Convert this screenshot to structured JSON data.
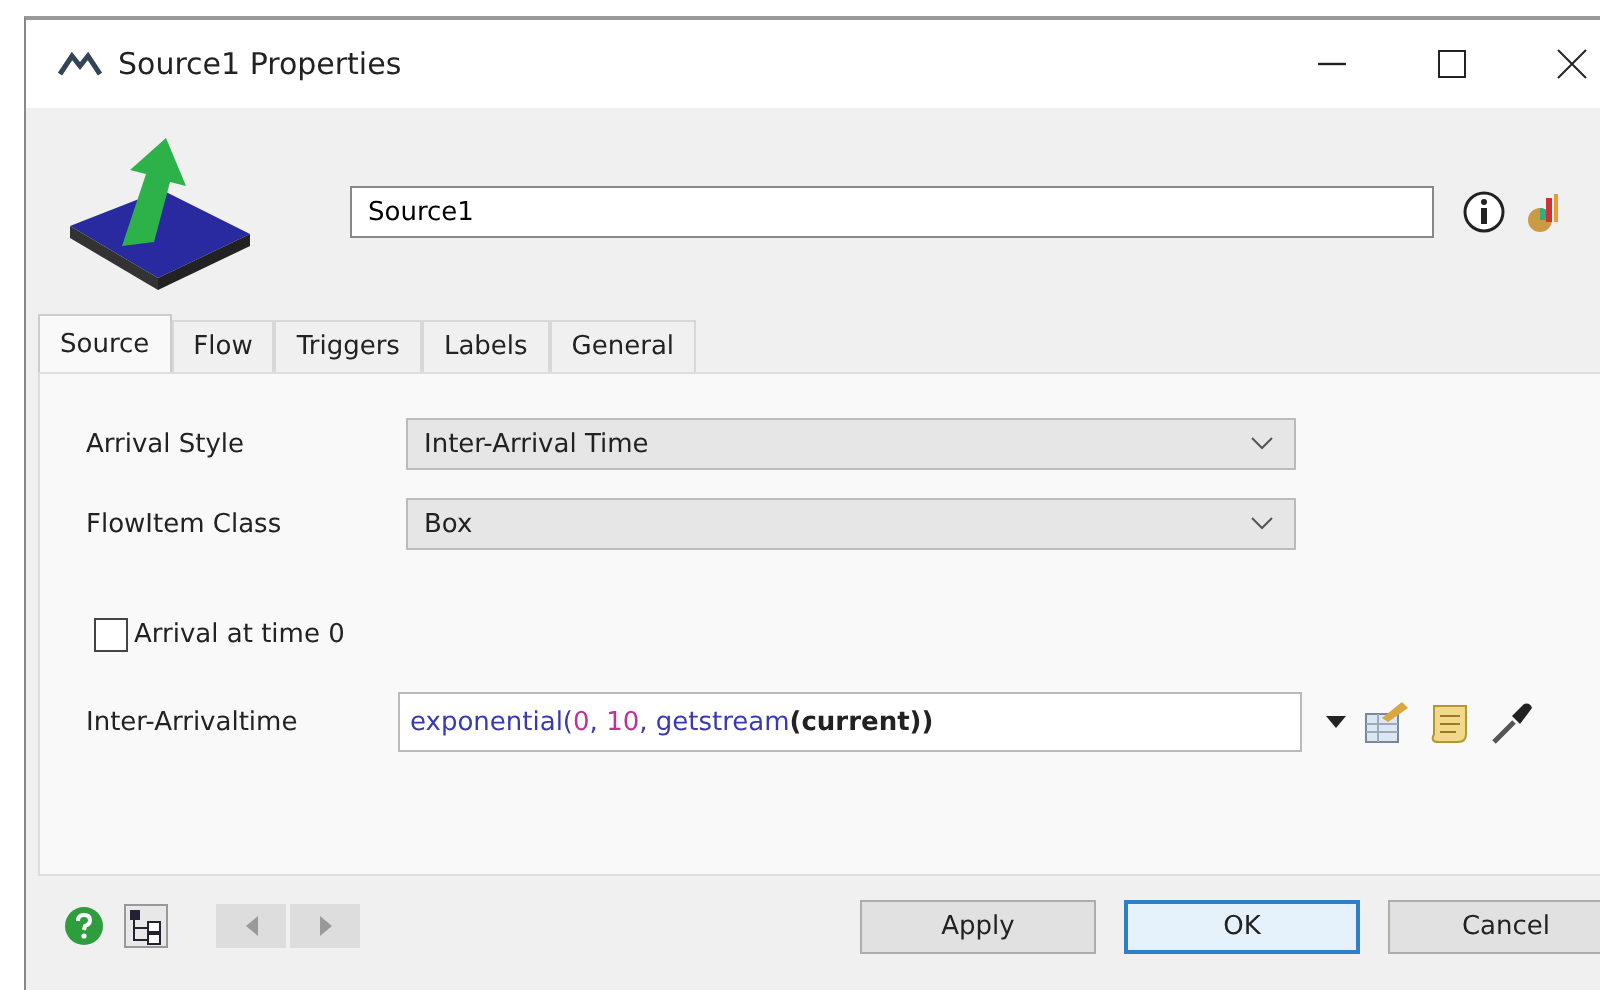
{
  "window": {
    "title": "Source1  Properties"
  },
  "name_field": {
    "value": "Source1"
  },
  "tabs": [
    {
      "label": "Source",
      "selected": true
    },
    {
      "label": "Flow",
      "selected": false
    },
    {
      "label": "Triggers",
      "selected": false
    },
    {
      "label": "Labels",
      "selected": false
    },
    {
      "label": "General",
      "selected": false
    }
  ],
  "fields": [
    {
      "label": "Arrival Style",
      "value": "Inter-Arrival Time"
    },
    {
      "label": "FlowItem Class",
      "value": "Box"
    }
  ],
  "arrival_at_time_0": {
    "label": "Arrival at time 0",
    "checked": false
  },
  "inter_arrival": {
    "label": "Inter-Arrivaltime",
    "tokens": [
      {
        "text": "exponential(",
        "kind": "func"
      },
      {
        "text": "0",
        "kind": "number"
      },
      {
        "text": ", ",
        "kind": "func"
      },
      {
        "text": "10",
        "kind": "number"
      },
      {
        "text": ", getstream",
        "kind": "func"
      },
      {
        "text": "(current))",
        "kind": "keyword"
      }
    ]
  },
  "buttons": [
    {
      "label": "Apply",
      "default": false
    },
    {
      "label": "OK",
      "default": true
    },
    {
      "label": "Cancel",
      "default": false
    }
  ]
}
